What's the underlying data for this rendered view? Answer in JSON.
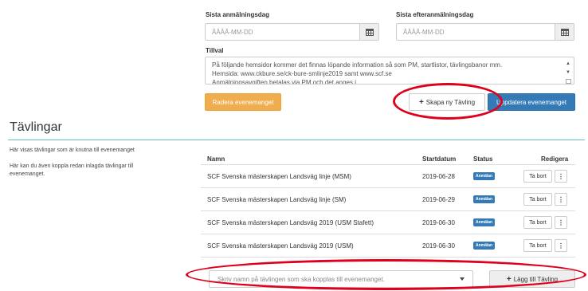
{
  "event_form": {
    "last_registration_label": "Sista anmälningsdag",
    "last_registration_placeholder": "ÅÅÅÅ-MM-DD",
    "last_late_registration_label": "Sista efteranmälningsdag",
    "last_late_registration_placeholder": "ÅÅÅÅ-MM-DD",
    "options_label": "Tillval",
    "options_text_line1": "På följande hemsidor kommer det finnas löpande information så som PM, startlistor, tävlingsbanor mm.",
    "options_text_line2": "Hemsida: www.ckbure.se/ck-bure-smlinje2019 samt www.scf.se",
    "options_text_line3": "Anmälningsavgiften betalas via PM och det anges i...",
    "delete_event_button": "Radera evenemanget",
    "create_competition_button": "Skapa ny Tävling",
    "update_event_button": "Uppdatera evenemanget"
  },
  "competitions": {
    "title": "Tävlingar",
    "description1": "Här visas tävlingar som är knutna till evenemanget",
    "description2_line1": "Här kan du även koppla redan inlagda tävlingar till",
    "description2_line2": "evenemanget.",
    "columns": {
      "name": "Namn",
      "start_date": "Startdatum",
      "status": "Status",
      "edit": "Redigera"
    },
    "rows": [
      {
        "name": "SCF Svenska mästerskapen Landsväg linje (MSM)",
        "date": "2019-06-28",
        "status": "Anmälan",
        "delete": "Ta bort"
      },
      {
        "name": "SCF Svenska mästerskapen Landsväg linje (SM)",
        "date": "2019-06-29",
        "status": "Anmälan",
        "delete": "Ta bort"
      },
      {
        "name": "SCF Svenska mästerskapen Landsväg 2019 (USM Stafett)",
        "date": "2019-06-30",
        "status": "Anmälan",
        "delete": "Ta bort"
      },
      {
        "name": "SCF Svenska mästerskapen Landsväg 2019 (USM)",
        "date": "2019-06-30",
        "status": "Anmälan",
        "delete": "Ta bort"
      }
    ],
    "link_placeholder": "Skriv namn på tävlingen som ska kopplas till evenemanget.",
    "add_button": "Lägg till Tävling"
  },
  "icons": {
    "calendar": "calendar-icon",
    "plus": "plus-icon",
    "kebab": "kebab-menu-icon",
    "caret": "chevron-down-icon"
  },
  "colors": {
    "orange_button": "#f0ad4e",
    "primary_blue": "#337ab7",
    "teal_rule": "#5bc0be",
    "annotation_red": "#e0001b"
  }
}
